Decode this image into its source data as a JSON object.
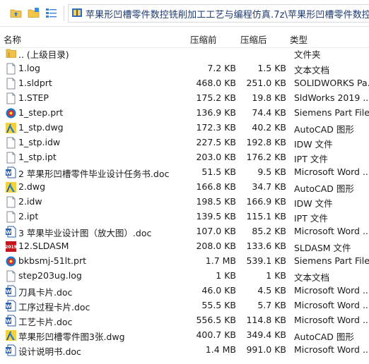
{
  "toolbar": {
    "icons": [
      "folder-up-icon",
      "new-folder-icon",
      "grid-view-icon"
    ],
    "address": "苹果形凹槽零件数控铣削加工工艺与编程仿真.7z\\苹果形凹槽零件数控铣削加"
  },
  "columns": {
    "name": "名称",
    "size": "压缩前",
    "csize": "压缩后",
    "type": "类型"
  },
  "files": [
    {
      "icon": "parent-folder-icon",
      "name": ".. (上级目录)",
      "size": "",
      "csize": "",
      "type": "文件夹"
    },
    {
      "icon": "text-file-icon",
      "name": "1.log",
      "size": "7.2 KB",
      "csize": "1.5 KB",
      "type": "文本文档"
    },
    {
      "icon": "text-file-icon",
      "name": "1.sldprt",
      "size": "468.0 KB",
      "csize": "251.0 KB",
      "type": "SOLIDWORKS Pa..."
    },
    {
      "icon": "text-file-icon",
      "name": "1.STEP",
      "size": "175.2 KB",
      "csize": "19.8 KB",
      "type": "SldWorks 2019 ..."
    },
    {
      "icon": "siemens-file-icon",
      "name": "1_step.prt",
      "size": "136.9 KB",
      "csize": "74.4 KB",
      "type": "Siemens Part File"
    },
    {
      "icon": "autocad-file-icon",
      "name": "1_stp.dwg",
      "size": "172.3 KB",
      "csize": "40.2 KB",
      "type": "AutoCAD 图形"
    },
    {
      "icon": "text-file-icon",
      "name": "1_stp.idw",
      "size": "227.5 KB",
      "csize": "192.8 KB",
      "type": "IDW 文件"
    },
    {
      "icon": "text-file-icon",
      "name": "1_stp.ipt",
      "size": "203.0 KB",
      "csize": "176.2 KB",
      "type": "IPT 文件"
    },
    {
      "icon": "word-file-icon",
      "name": "2 苹果形凹槽零件毕业设计任务书.doc",
      "size": "51.5 KB",
      "csize": "9.5 KB",
      "type": "Microsoft Word ..."
    },
    {
      "icon": "autocad-file-icon",
      "name": "2.dwg",
      "size": "166.8 KB",
      "csize": "34.7 KB",
      "type": "AutoCAD 图形"
    },
    {
      "icon": "text-file-icon",
      "name": "2.idw",
      "size": "198.5 KB",
      "csize": "166.9 KB",
      "type": "IDW 文件"
    },
    {
      "icon": "text-file-icon",
      "name": "2.ipt",
      "size": "139.5 KB",
      "csize": "115.1 KB",
      "type": "IPT 文件"
    },
    {
      "icon": "word-file-icon",
      "name": "3 苹果毕业设计图（放大图）.doc",
      "size": "107.0 KB",
      "csize": "85.2 KB",
      "type": "Microsoft Word ..."
    },
    {
      "icon": "sldasm-file-icon",
      "name": "12.SLDASM",
      "size": "208.0 KB",
      "csize": "133.6 KB",
      "type": "SLDASM 文件"
    },
    {
      "icon": "siemens-file-icon",
      "name": "bkbsmj-51lt.prt",
      "size": "1.7 MB",
      "csize": "539.1 KB",
      "type": "Siemens Part File"
    },
    {
      "icon": "text-file-icon",
      "name": "step203ug.log",
      "size": "1 KB",
      "csize": "1 KB",
      "type": "文本文档"
    },
    {
      "icon": "word-file-icon",
      "name": "刀具卡片.doc",
      "size": "46.0 KB",
      "csize": "4.5 KB",
      "type": "Microsoft Word ..."
    },
    {
      "icon": "word-file-icon",
      "name": "工序过程卡片.doc",
      "size": "55.5 KB",
      "csize": "5.7 KB",
      "type": "Microsoft Word ..."
    },
    {
      "icon": "word-file-icon",
      "name": "工艺卡片.doc",
      "size": "556.5 KB",
      "csize": "114.8 KB",
      "type": "Microsoft Word ..."
    },
    {
      "icon": "autocad-file-icon",
      "name": "苹果形凹槽零件图3张.dwg",
      "size": "400.7 KB",
      "csize": "349.4 KB",
      "type": "AutoCAD 图形"
    },
    {
      "icon": "word-file-icon",
      "name": "设计说明书.doc",
      "size": "1.4 MB",
      "csize": "991.0 KB",
      "type": "Microsoft Word ..."
    }
  ]
}
